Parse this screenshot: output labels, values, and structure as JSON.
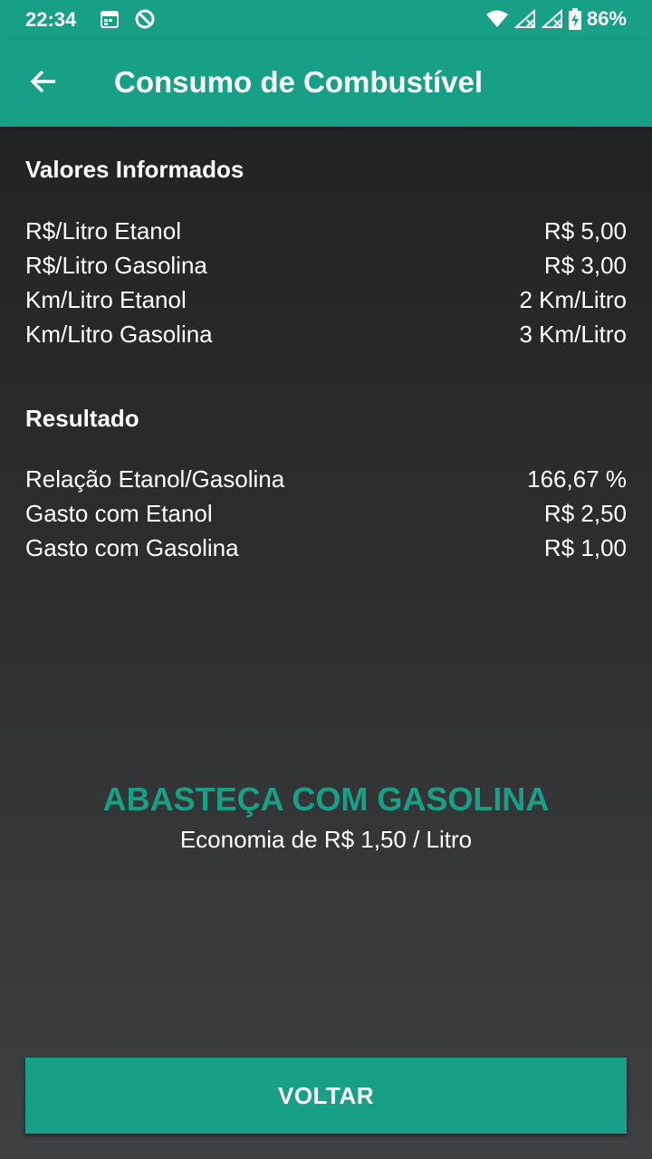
{
  "status_bar": {
    "time": "22:34",
    "battery": "86%",
    "icons": [
      "calendar-icon",
      "sync-icon",
      "wifi-icon",
      "signal-icon",
      "signal-icon",
      "battery-charging-icon"
    ]
  },
  "app_bar": {
    "title": "Consumo de Combustível",
    "back_icon": "arrow-back-icon"
  },
  "informed": {
    "title": "Valores Informados",
    "rows": [
      {
        "label": "R$/Litro Etanol",
        "value": "R$ 5,00"
      },
      {
        "label": "R$/Litro Gasolina",
        "value": "R$ 3,00"
      },
      {
        "label": "Km/Litro Etanol",
        "value": "2 Km/Litro"
      },
      {
        "label": "Km/Litro Gasolina",
        "value": "3 Km/Litro"
      }
    ]
  },
  "result": {
    "title": "Resultado",
    "rows": [
      {
        "label": "Relação Etanol/Gasolina",
        "value": "166,67 %"
      },
      {
        "label": "Gasto com Etanol",
        "value": "R$ 2,50"
      },
      {
        "label": "Gasto com Gasolina",
        "value": "R$ 1,00"
      }
    ]
  },
  "recommendation": {
    "text": "ABASTEÇA COM GASOLINA",
    "economy": "Economia de R$ 1,50 / Litro"
  },
  "actions": {
    "back_label": "VOLTAR"
  },
  "colors": {
    "accent": "#18a086",
    "background_top": "#1f2022",
    "background_bottom": "#3f4042",
    "text": "#ffffff"
  }
}
